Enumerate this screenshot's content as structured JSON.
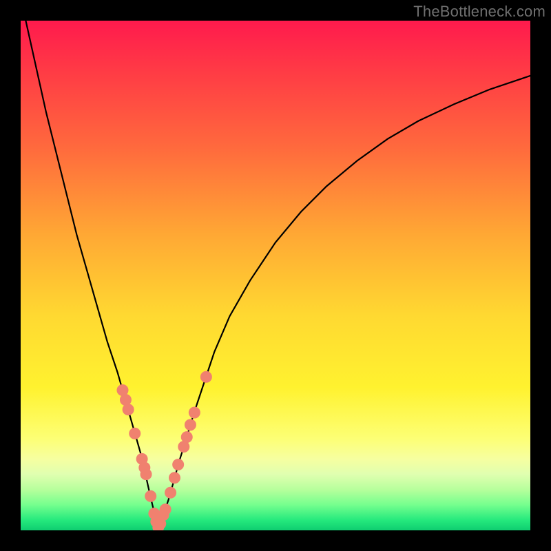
{
  "watermark": "TheBottleneck.com",
  "chart_data": {
    "type": "line",
    "title": "",
    "xlabel": "",
    "ylabel": "",
    "xlim": [
      0,
      100
    ],
    "ylim": [
      0,
      100
    ],
    "series": [
      {
        "name": "left-branch",
        "x": [
          1,
          3,
          5,
          7,
          9,
          11,
          13,
          15,
          17,
          19,
          20,
          21,
          22,
          23,
          24,
          24.6,
          25.2,
          25.8,
          26.4,
          27
        ],
        "y": [
          100,
          91,
          82,
          74,
          66,
          58,
          51,
          44,
          37,
          31,
          27.5,
          24,
          20.5,
          17,
          13.5,
          10.5,
          7.8,
          5.2,
          2.8,
          0.6
        ]
      },
      {
        "name": "right-branch",
        "x": [
          27,
          28,
          29,
          30,
          31,
          32.5,
          34,
          36,
          38,
          41,
          45,
          50,
          55,
          60,
          66,
          72,
          78,
          85,
          92,
          100
        ],
        "y": [
          0.6,
          3,
          6,
          9.5,
          13.2,
          18,
          23,
          29,
          35,
          42,
          49,
          56.5,
          62.5,
          67.5,
          72.5,
          76.8,
          80.3,
          83.6,
          86.5,
          89.2
        ]
      }
    ],
    "markers": [
      {
        "name": "left-dot",
        "x": 20.0,
        "y": 27.5
      },
      {
        "name": "left-dot",
        "x": 20.6,
        "y": 25.6
      },
      {
        "name": "left-dot",
        "x": 21.1,
        "y": 23.7
      },
      {
        "name": "left-dot",
        "x": 22.4,
        "y": 19.0
      },
      {
        "name": "left-dot",
        "x": 23.8,
        "y": 14.0
      },
      {
        "name": "left-dot",
        "x": 24.3,
        "y": 12.3
      },
      {
        "name": "left-dot",
        "x": 24.6,
        "y": 11.0
      },
      {
        "name": "left-dot",
        "x": 25.5,
        "y": 6.7
      },
      {
        "name": "left-dot",
        "x": 26.2,
        "y": 3.3
      },
      {
        "name": "left-dot",
        "x": 26.6,
        "y": 1.7
      },
      {
        "name": "left-dot",
        "x": 27.0,
        "y": 0.6
      },
      {
        "name": "right-dot",
        "x": 27.4,
        "y": 1.3
      },
      {
        "name": "right-dot",
        "x": 28.0,
        "y": 3.0
      },
      {
        "name": "right-dot",
        "x": 28.4,
        "y": 4.1
      },
      {
        "name": "right-dot",
        "x": 29.4,
        "y": 7.4
      },
      {
        "name": "right-dot",
        "x": 30.2,
        "y": 10.3
      },
      {
        "name": "right-dot",
        "x": 30.9,
        "y": 12.9
      },
      {
        "name": "right-dot",
        "x": 32.0,
        "y": 16.4
      },
      {
        "name": "right-dot",
        "x": 32.6,
        "y": 18.3
      },
      {
        "name": "right-dot",
        "x": 33.3,
        "y": 20.7
      },
      {
        "name": "right-dot",
        "x": 34.1,
        "y": 23.1
      },
      {
        "name": "right-dot",
        "x": 36.4,
        "y": 30.1
      }
    ],
    "colors": {
      "curve": "#000000",
      "marker_fill": "#f0816f",
      "marker_stroke": "#f0816f"
    }
  }
}
